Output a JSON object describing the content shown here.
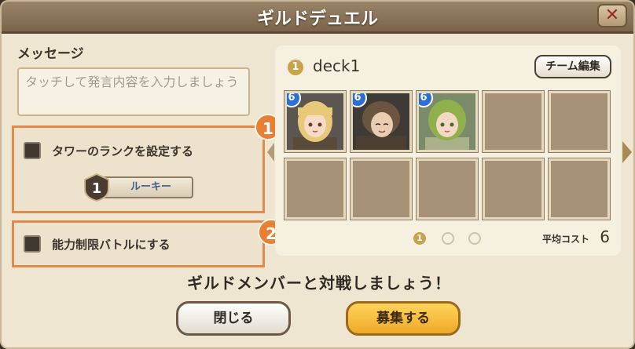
{
  "dialog": {
    "title": "ギルドデュエル",
    "close_glyph": "✕"
  },
  "message": {
    "label": "メッセージ",
    "placeholder": "タッチして発言内容を入力しましょう"
  },
  "options": [
    {
      "label": "タワーのランクを設定する",
      "callout": "1"
    },
    {
      "label": "能力制限バトルにする",
      "callout": "2"
    }
  ],
  "rank": {
    "number": "1",
    "label": "ルーキー"
  },
  "deck": {
    "index": "1",
    "name": "deck1",
    "team_button": "チーム編集",
    "characters": [
      {
        "level": "6",
        "hair": "#e8c97a",
        "skin": "#f6dcc8",
        "cloth": "#5a4a3a"
      },
      {
        "level": "6",
        "hair": "#6a5540",
        "skin": "#e9cdb2",
        "cloth": "#4a3f30"
      },
      {
        "level": "6",
        "hair": "#8fb04a",
        "skin": "#f3d9c3",
        "cloth": "#a9b08a"
      }
    ],
    "pager": {
      "active": "1"
    },
    "avg_cost_label": "平均コスト",
    "avg_cost_value": "6"
  },
  "footer": {
    "message": "ギルドメンバーと対戦しましょう！",
    "close_button": "閉じる",
    "recruit_button": "募集する"
  },
  "colors": {
    "accent": "#e77f35",
    "level_badge": "#2c6fd4",
    "recruit": "#f0a928"
  }
}
